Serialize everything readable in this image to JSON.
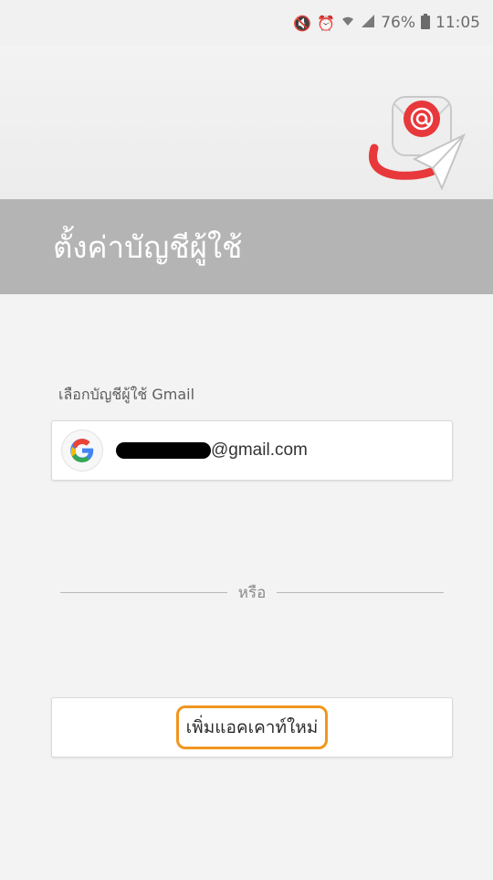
{
  "status_bar": {
    "battery": "76%",
    "time": "11:05",
    "icons": [
      "mute-icon",
      "alarm-icon",
      "wifi-icon",
      "signal-icon",
      "battery-icon"
    ]
  },
  "header": {
    "title": "ตั้งค่าบัญชีผู้ใช้"
  },
  "account_section": {
    "label": "เลือกบัญชีผู้ใช้ Gmail",
    "email_suffix": "@gmail.com"
  },
  "divider": {
    "text": "หรือ"
  },
  "add_account": {
    "label": "เพิ่มแอคเคาท์ใหม่"
  },
  "colors": {
    "title_bar": "#b4b4b4",
    "highlight": "#f0961e",
    "logo_red": "#e8383b"
  }
}
